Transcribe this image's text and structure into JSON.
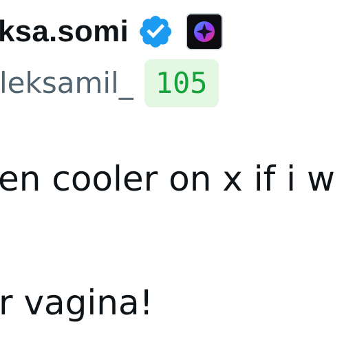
{
  "user": {
    "display_name_visible": "ksa.somi",
    "handle_visible": "leksamil_",
    "count_badge": "105",
    "verified_icon": "verified-check-icon",
    "affiliate_icon": "affiliate-sparkle-icon"
  },
  "tweet": {
    "lines": [
      "en cooler on x if i w",
      "r vagina!"
    ]
  },
  "colors": {
    "verified_blue": "#1d9bf0",
    "handle_gray": "#536471",
    "badge_green_bg": "#e3f7e3",
    "badge_green_text": "#14a33a",
    "text": "#0f1419"
  }
}
